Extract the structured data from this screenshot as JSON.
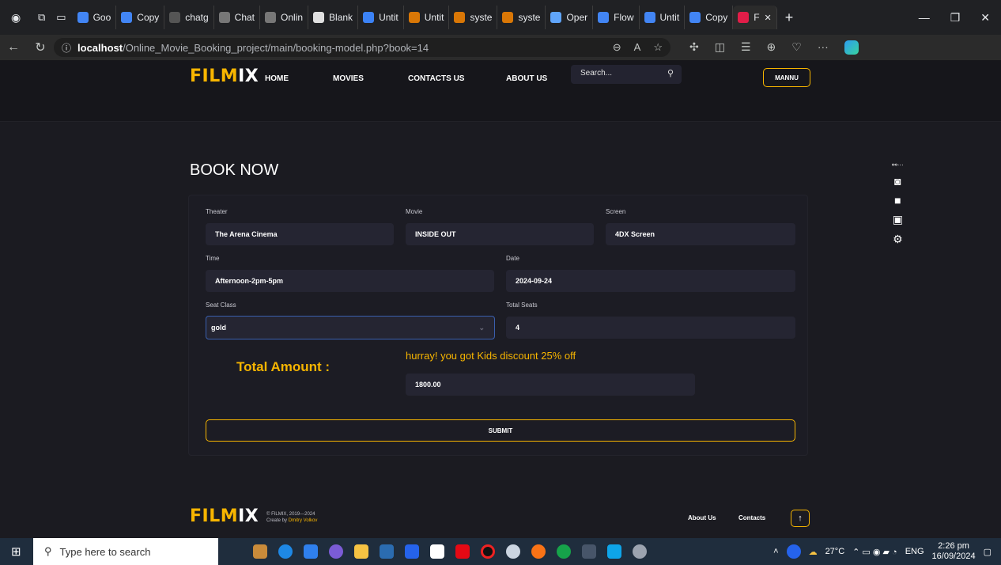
{
  "browser": {
    "tabs": [
      {
        "label": "Goo",
        "color": "#4285f4"
      },
      {
        "label": "Copy",
        "color": "#4285f4"
      },
      {
        "label": "chatg",
        "color": "#555555"
      },
      {
        "label": "Chat",
        "color": "#777777"
      },
      {
        "label": "Onlin",
        "color": "#777777"
      },
      {
        "label": "Blank",
        "color": "#e0e0e0"
      },
      {
        "label": "Untit",
        "color": "#3b82f6"
      },
      {
        "label": "Untit",
        "color": "#d97706"
      },
      {
        "label": "syste",
        "color": "#d97706"
      },
      {
        "label": "syste",
        "color": "#d97706"
      },
      {
        "label": "Oper",
        "color": "#60a5fa"
      },
      {
        "label": "Flow",
        "color": "#4285f4"
      },
      {
        "label": "Untit",
        "color": "#4285f4"
      },
      {
        "label": "Copy",
        "color": "#4285f4"
      },
      {
        "label": "F",
        "color": "#e11d48"
      }
    ],
    "new_tab": "+",
    "url_host": "localhost",
    "url_path": "/Online_Movie_Booking_project/main/booking-model.php?book=14"
  },
  "site": {
    "logo_a": "FILM",
    "logo_b": "IX",
    "nav": [
      "HOME",
      "MOVIES",
      "CONTACTS US",
      "ABOUT US"
    ],
    "search_placeholder": "Search...",
    "user": "MANNU"
  },
  "booking": {
    "title": "BOOK NOW",
    "theater_label": "Theater",
    "theater": "The Arena Cinema",
    "movie_label": "Movie",
    "movie": "INSIDE OUT",
    "screen_label": "Screen",
    "screen": "4DX Screen",
    "time_label": "Time",
    "time": "Afternoon-2pm-5pm",
    "date_label": "Date",
    "date": "2024-09-24",
    "seat_class_label": "Seat Class",
    "seat_class": "gold",
    "total_seats_label": "Total Seats",
    "total_seats": "4",
    "total_amount_label": "Total Amount :",
    "promo": "hurray! you got Kids discount 25% off",
    "total_amount": "1800.00",
    "submit": "SUBMIT"
  },
  "footer": {
    "copyright": "© FILMIX, 2019—2024",
    "created_by": "Create by",
    "author": "Dmitry Volkov",
    "links": [
      "About Us",
      "Contacts"
    ],
    "up": "↑"
  },
  "taskbar": {
    "search_placeholder": "Type here to search",
    "weather": "27°C",
    "lang": "ENG",
    "time": "2:26 pm",
    "date": "16/09/2024"
  }
}
